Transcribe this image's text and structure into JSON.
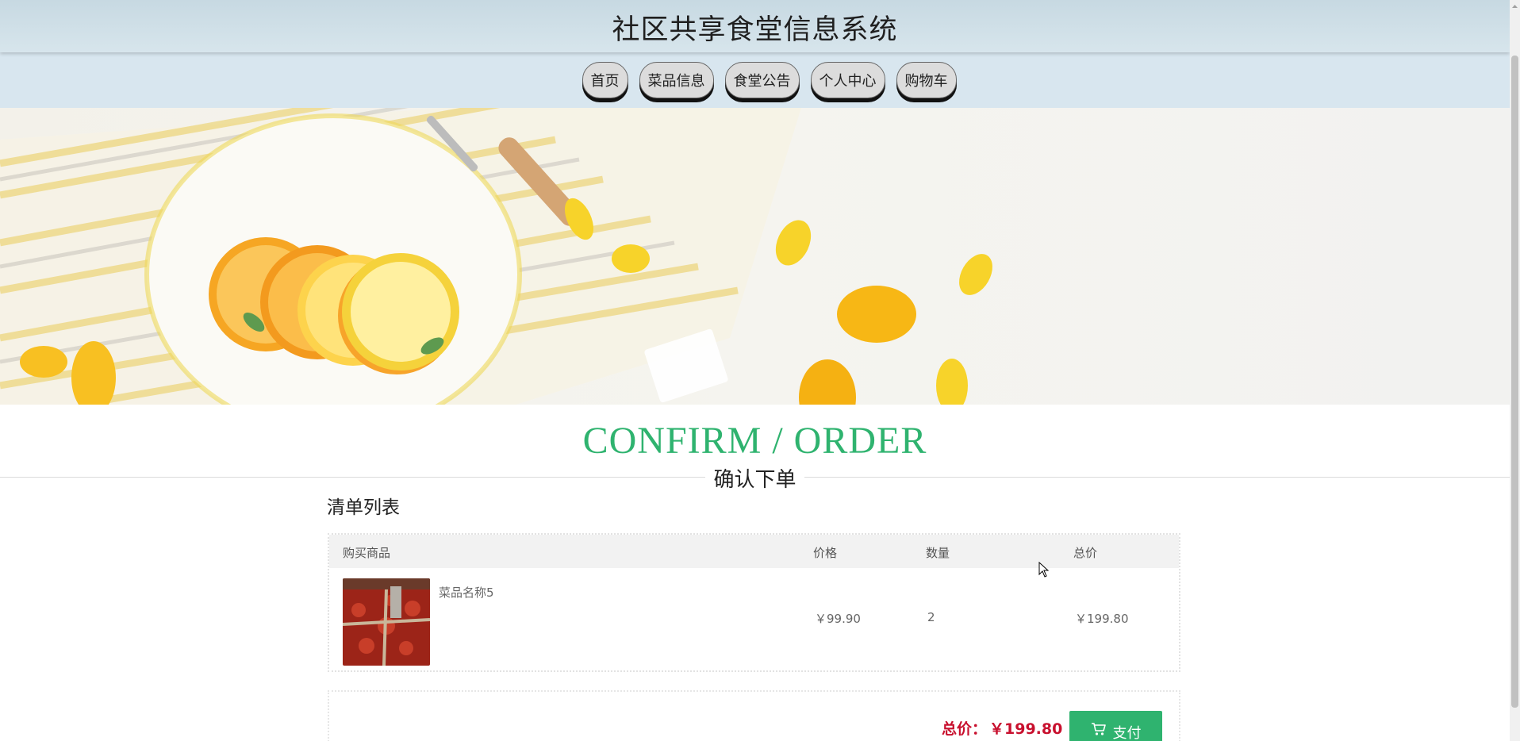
{
  "header": {
    "title": "社区共享食堂信息系统"
  },
  "nav": {
    "items": [
      "首页",
      "菜品信息",
      "食堂公告",
      "个人中心",
      "购物车"
    ]
  },
  "section": {
    "heading_en": "CONFIRM / ORDER",
    "heading_cn": "确认下单",
    "list_title": "清单列表"
  },
  "table": {
    "headers": {
      "product": "购买商品",
      "price": "价格",
      "quantity": "数量",
      "total": "总价"
    },
    "rows": [
      {
        "name": "菜品名称5",
        "price": "￥99.90",
        "quantity": "2",
        "total": "￥199.80"
      }
    ]
  },
  "summary": {
    "total_label": "总价：",
    "total_value": "￥199.80",
    "pay_label": "支付"
  },
  "colors": {
    "accent": "#2fb36f",
    "price_red": "#c8102e",
    "header_bg": "#c7d9e2",
    "nav_bg": "#d8e6ef"
  },
  "icons": {
    "pay": "cart-icon"
  }
}
